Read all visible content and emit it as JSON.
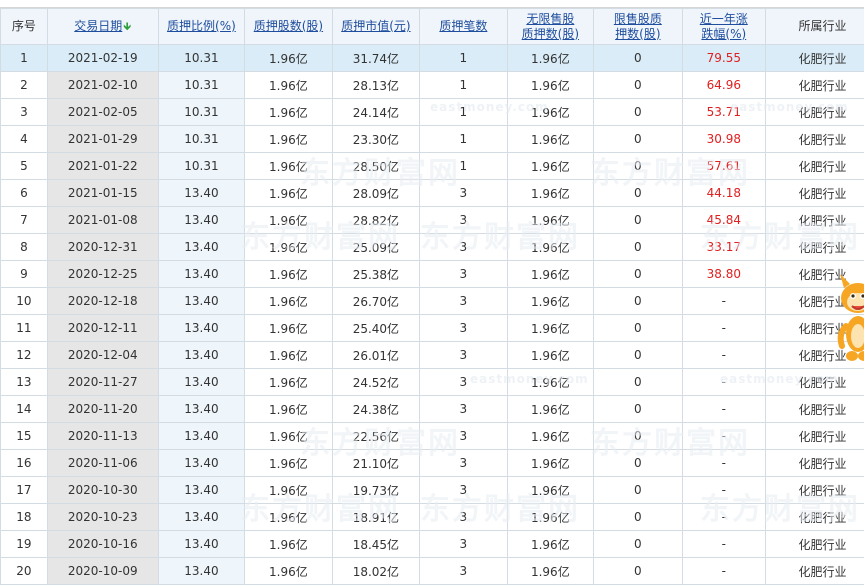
{
  "headers": [
    "序号",
    "交易日期",
    "质押比例(%)",
    "质押股数(股)",
    "质押市值(元)",
    "质押笔数",
    "无限售股质押数(股)",
    "限售股质押数(股)",
    "近一年涨跌幅(%)",
    "所属行业"
  ],
  "headers_split": {
    "6": [
      "无限售股",
      "质押数(股)"
    ],
    "7": [
      "限售股质",
      "押数(股)"
    ],
    "8": [
      "近一年涨",
      "跌幅(%)"
    ]
  },
  "sort_icon": "down-arrow-icon",
  "colors": {
    "header_bg": "#f0f5fb",
    "selected_row": "#d9ecf7",
    "red_value": "#e02020",
    "link": "#1f4e9e",
    "sort_arrow": "#2e9e3a"
  },
  "watermark": {
    "cn": "东方财富网",
    "en": "eastmoney.com"
  },
  "rows": [
    {
      "no": "1",
      "date": "2021-02-19",
      "ratio": "10.31",
      "shares": "1.96亿",
      "value": "31.74亿",
      "count": "1",
      "unrestricted": "1.96亿",
      "restricted": "0",
      "change": "79.55",
      "industry": "化肥行业"
    },
    {
      "no": "2",
      "date": "2021-02-10",
      "ratio": "10.31",
      "shares": "1.96亿",
      "value": "28.13亿",
      "count": "1",
      "unrestricted": "1.96亿",
      "restricted": "0",
      "change": "64.96",
      "industry": "化肥行业"
    },
    {
      "no": "3",
      "date": "2021-02-05",
      "ratio": "10.31",
      "shares": "1.96亿",
      "value": "24.14亿",
      "count": "1",
      "unrestricted": "1.96亿",
      "restricted": "0",
      "change": "53.71",
      "industry": "化肥行业"
    },
    {
      "no": "4",
      "date": "2021-01-29",
      "ratio": "10.31",
      "shares": "1.96亿",
      "value": "23.30亿",
      "count": "1",
      "unrestricted": "1.96亿",
      "restricted": "0",
      "change": "30.98",
      "industry": "化肥行业"
    },
    {
      "no": "5",
      "date": "2021-01-22",
      "ratio": "10.31",
      "shares": "1.96亿",
      "value": "28.50亿",
      "count": "1",
      "unrestricted": "1.96亿",
      "restricted": "0",
      "change": "57.61",
      "industry": "化肥行业"
    },
    {
      "no": "6",
      "date": "2021-01-15",
      "ratio": "13.40",
      "shares": "1.96亿",
      "value": "28.09亿",
      "count": "3",
      "unrestricted": "1.96亿",
      "restricted": "0",
      "change": "44.18",
      "industry": "化肥行业"
    },
    {
      "no": "7",
      "date": "2021-01-08",
      "ratio": "13.40",
      "shares": "1.96亿",
      "value": "28.82亿",
      "count": "3",
      "unrestricted": "1.96亿",
      "restricted": "0",
      "change": "45.84",
      "industry": "化肥行业"
    },
    {
      "no": "8",
      "date": "2020-12-31",
      "ratio": "13.40",
      "shares": "1.96亿",
      "value": "25.09亿",
      "count": "3",
      "unrestricted": "1.96亿",
      "restricted": "0",
      "change": "33.17",
      "industry": "化肥行业"
    },
    {
      "no": "9",
      "date": "2020-12-25",
      "ratio": "13.40",
      "shares": "1.96亿",
      "value": "25.38亿",
      "count": "3",
      "unrestricted": "1.96亿",
      "restricted": "0",
      "change": "38.80",
      "industry": "化肥行业"
    },
    {
      "no": "10",
      "date": "2020-12-18",
      "ratio": "13.40",
      "shares": "1.96亿",
      "value": "26.70亿",
      "count": "3",
      "unrestricted": "1.96亿",
      "restricted": "0",
      "change": "-",
      "industry": "化肥行业"
    },
    {
      "no": "11",
      "date": "2020-12-11",
      "ratio": "13.40",
      "shares": "1.96亿",
      "value": "25.40亿",
      "count": "3",
      "unrestricted": "1.96亿",
      "restricted": "0",
      "change": "-",
      "industry": "化肥行业"
    },
    {
      "no": "12",
      "date": "2020-12-04",
      "ratio": "13.40",
      "shares": "1.96亿",
      "value": "26.01亿",
      "count": "3",
      "unrestricted": "1.96亿",
      "restricted": "0",
      "change": "-",
      "industry": "化肥行业"
    },
    {
      "no": "13",
      "date": "2020-11-27",
      "ratio": "13.40",
      "shares": "1.96亿",
      "value": "24.52亿",
      "count": "3",
      "unrestricted": "1.96亿",
      "restricted": "0",
      "change": "-",
      "industry": "化肥行业"
    },
    {
      "no": "14",
      "date": "2020-11-20",
      "ratio": "13.40",
      "shares": "1.96亿",
      "value": "24.38亿",
      "count": "3",
      "unrestricted": "1.96亿",
      "restricted": "0",
      "change": "-",
      "industry": "化肥行业"
    },
    {
      "no": "15",
      "date": "2020-11-13",
      "ratio": "13.40",
      "shares": "1.96亿",
      "value": "22.56亿",
      "count": "3",
      "unrestricted": "1.96亿",
      "restricted": "0",
      "change": "-",
      "industry": "化肥行业"
    },
    {
      "no": "16",
      "date": "2020-11-06",
      "ratio": "13.40",
      "shares": "1.96亿",
      "value": "21.10亿",
      "count": "3",
      "unrestricted": "1.96亿",
      "restricted": "0",
      "change": "-",
      "industry": "化肥行业"
    },
    {
      "no": "17",
      "date": "2020-10-30",
      "ratio": "13.40",
      "shares": "1.96亿",
      "value": "19.73亿",
      "count": "3",
      "unrestricted": "1.96亿",
      "restricted": "0",
      "change": "-",
      "industry": "化肥行业"
    },
    {
      "no": "18",
      "date": "2020-10-23",
      "ratio": "13.40",
      "shares": "1.96亿",
      "value": "18.91亿",
      "count": "3",
      "unrestricted": "1.96亿",
      "restricted": "0",
      "change": "-",
      "industry": "化肥行业"
    },
    {
      "no": "19",
      "date": "2020-10-16",
      "ratio": "13.40",
      "shares": "1.96亿",
      "value": "18.45亿",
      "count": "3",
      "unrestricted": "1.96亿",
      "restricted": "0",
      "change": "-",
      "industry": "化肥行业"
    },
    {
      "no": "20",
      "date": "2020-10-09",
      "ratio": "13.40",
      "shares": "1.96亿",
      "value": "18.02亿",
      "count": "3",
      "unrestricted": "1.96亿",
      "restricted": "0",
      "change": "-",
      "industry": "化肥行业"
    }
  ]
}
